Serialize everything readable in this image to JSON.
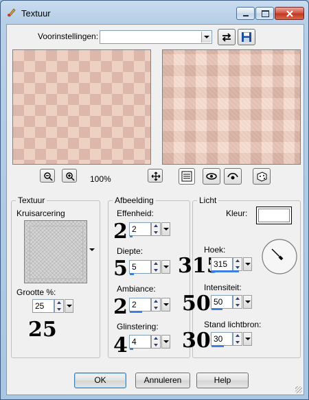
{
  "window": {
    "title": "Textuur"
  },
  "presets": {
    "label": "Voorinstellingen:",
    "value": ""
  },
  "zoom": {
    "level": "100%"
  },
  "texture_group": {
    "title": "Textuur",
    "pattern_name": "Kruisarcering",
    "size_label": "Grootte %:",
    "size_value": "25",
    "size_annotation": "25"
  },
  "image_group": {
    "title": "Afbeelding",
    "smoothness": {
      "label": "Effenheid:",
      "value": "2",
      "annotation": "2"
    },
    "depth": {
      "label": "Diepte:",
      "value": "5",
      "annotation": "5"
    },
    "ambience": {
      "label": "Ambiance:",
      "value": "2",
      "annotation": "2"
    },
    "shininess": {
      "label": "Glinstering:",
      "value": "4",
      "annotation": "4"
    }
  },
  "light_group": {
    "title": "Licht",
    "color_label": "Kleur:",
    "angle": {
      "label": "Hoek:",
      "value": "315",
      "annotation": "315"
    },
    "intensity": {
      "label": "Intensiteit:",
      "value": "50",
      "annotation": "50"
    },
    "elevation": {
      "label": "Stand lichtbron:",
      "value": "30",
      "annotation": "30"
    }
  },
  "buttons": {
    "ok": "OK",
    "cancel": "Annuleren",
    "help": "Help"
  },
  "icons": [
    "app-icon",
    "minimize-icon",
    "maximize-icon",
    "close-icon",
    "save-preset-icon",
    "undo-arrows-icon",
    "zoom-out-icon",
    "zoom-in-icon",
    "move-icon",
    "proof-icon",
    "reset-icon",
    "randomize-icon",
    "dice-icon"
  ],
  "colors": {
    "title_bar": "#b7cfe7",
    "client": "#f0f0f0",
    "preview": "#efd1c3",
    "accent": "#3d7fe0"
  }
}
